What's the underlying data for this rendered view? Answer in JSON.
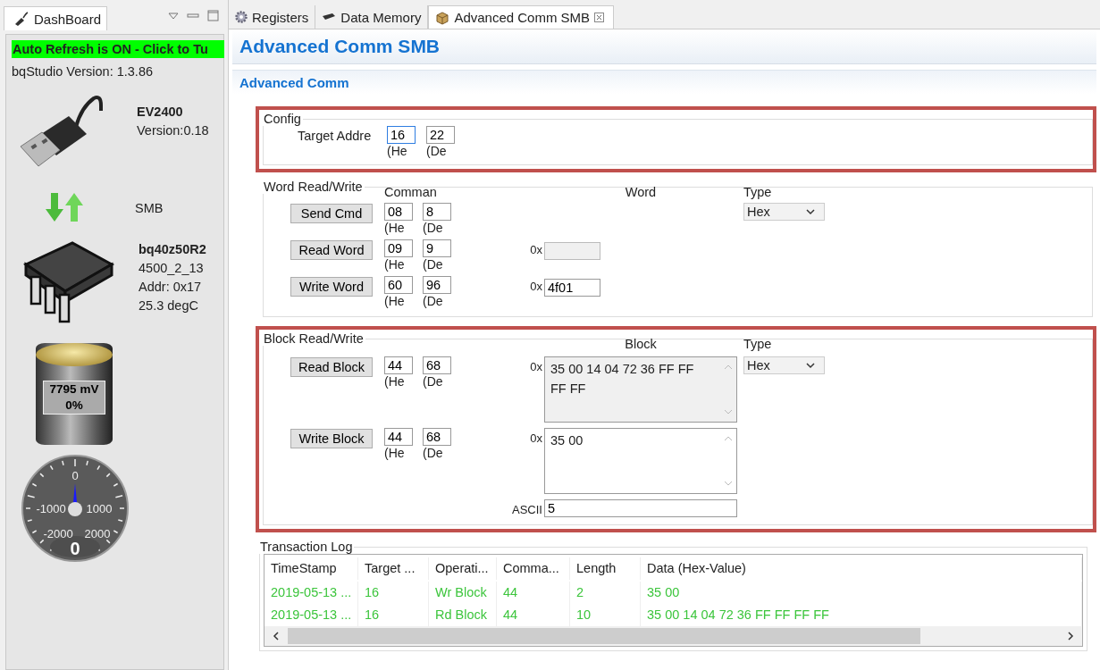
{
  "dashboard": {
    "tab": "DashBoard",
    "auto_refresh": "Auto Refresh is ON - Click to Tu",
    "version_label": "bqStudio Version:",
    "version": "1.3.86",
    "adapter": {
      "name": "EV2400",
      "version": "Version:0.18"
    },
    "bus": "SMB",
    "device": {
      "name": "bq40z50R2",
      "lines": [
        "4500_2_13",
        "Addr: 0x17",
        "25.3 degC"
      ]
    },
    "battery": {
      "voltage": "7795 mV",
      "charge": "0%"
    },
    "gauge": {
      "labels": [
        "0",
        "-1000",
        "1000",
        "-2000",
        "2000"
      ],
      "reading": "0"
    }
  },
  "tabs": [
    {
      "label": "Registers",
      "kind": "gear",
      "selected": false,
      "closable": false
    },
    {
      "label": "Data Memory",
      "kind": "memory",
      "selected": false,
      "closable": false
    },
    {
      "label": "Advanced Comm SMB",
      "kind": "package",
      "selected": true,
      "closable": true
    }
  ],
  "page_title": "Advanced Comm SMB",
  "section_title": "Advanced Comm",
  "config": {
    "legend": "Config",
    "highlighted": true,
    "label": "Target Addre",
    "hex": "16",
    "dec": "22",
    "hex_caption": "(He",
    "dec_caption": "(De",
    "focused": true
  },
  "word": {
    "legend": "Word Read/Write",
    "highlighted": false,
    "headers": {
      "command": "Comman",
      "data": "Word",
      "type": "Type"
    },
    "type_value": "Hex",
    "rows": [
      {
        "kind": "command",
        "button": "Send Cmd",
        "hex": "08",
        "dec": "8",
        "hex_caption": "(He",
        "dec_caption": "(De"
      },
      {
        "kind": "read",
        "button": "Read Word",
        "hex": "09",
        "dec": "9",
        "hex_caption": "(He",
        "dec_caption": "(De",
        "prefix": "0x",
        "value": ""
      },
      {
        "kind": "write",
        "button": "Write Word",
        "hex": "60",
        "dec": "96",
        "hex_caption": "(He",
        "dec_caption": "(De",
        "prefix": "0x",
        "value": "4f01"
      }
    ]
  },
  "block": {
    "legend": "Block Read/Write",
    "highlighted": true,
    "headers": {
      "data": "Block",
      "type": "Type"
    },
    "type_value": "Hex",
    "rows": [
      {
        "kind": "read",
        "button": "Read Block",
        "hex": "44",
        "dec": "68",
        "hex_caption": "(He",
        "dec_caption": "(De",
        "prefix": "0x",
        "value": "35 00 14 04 72 36 FF FF FF FF"
      },
      {
        "kind": "write",
        "button": "Write Block",
        "hex": "44",
        "dec": "68",
        "hex_caption": "(He",
        "dec_caption": "(De",
        "prefix": "0x",
        "value": "35 00"
      }
    ],
    "ascii_label": "ASCII",
    "ascii_value": "5"
  },
  "log": {
    "legend": "Transaction Log",
    "columns": [
      "TimeStamp",
      "Target ...",
      "Operati...",
      "Comma...",
      "Length",
      "Data (Hex-Value)"
    ],
    "rows": [
      [
        "2019-05-13 ...",
        "16",
        "Wr Block",
        "44",
        "2",
        "35 00"
      ],
      [
        "2019-05-13 ...",
        "16",
        "Rd Block",
        "44",
        "10",
        "35 00 14 04 72 36 FF FF FF FF"
      ]
    ]
  }
}
